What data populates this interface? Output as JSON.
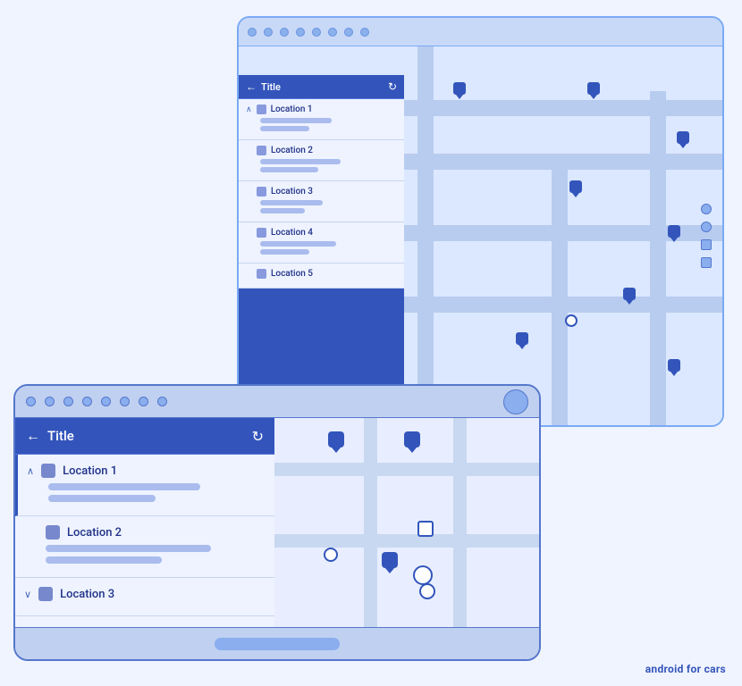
{
  "backWindow": {
    "panel": {
      "backArrow": "←",
      "title": "Title",
      "refreshIcon": "↻",
      "locations": [
        {
          "name": "Location 1",
          "bar1Width": "80px",
          "bar2Width": "55px"
        },
        {
          "name": "Location 2",
          "bar1Width": "90px",
          "bar2Width": "65px"
        },
        {
          "name": "Location 3",
          "bar1Width": "70px",
          "bar2Width": "50px"
        },
        {
          "name": "Location 4",
          "bar1Width": "85px",
          "bar2Width": "55px"
        },
        {
          "name": "Location 5",
          "bar1Width": "75px",
          "bar2Width": "45px"
        }
      ]
    }
  },
  "frontWindow": {
    "sidebar": {
      "backArrow": "←",
      "title": "Title",
      "refreshIcon": "↻",
      "locations": [
        {
          "name": "Location 1",
          "chevron": "∧",
          "bar1Width": "170px",
          "bar2Width": "120px",
          "expanded": true
        },
        {
          "name": "Location 2",
          "chevron": "",
          "bar1Width": "185px",
          "bar2Width": "130px",
          "expanded": false
        },
        {
          "name": "Location 3",
          "chevron": "∨",
          "bar1Width": "160px",
          "bar2Width": "",
          "expanded": false
        }
      ]
    }
  },
  "brandLabel": {
    "prefix": "android",
    "suffix": "for cars"
  },
  "scrollIndicators": {
    "items": [
      "dot",
      "dot",
      "square",
      "square"
    ]
  }
}
